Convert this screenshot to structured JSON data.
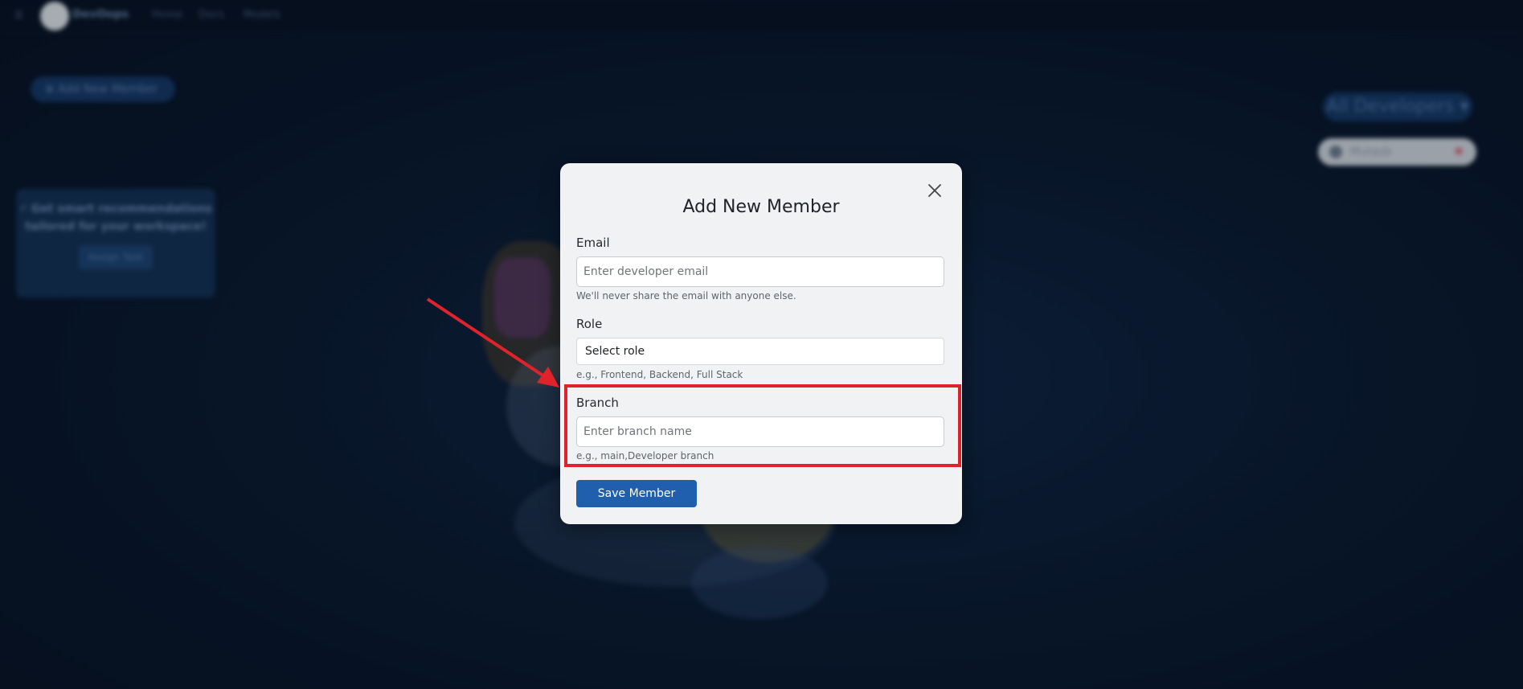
{
  "background": {
    "brand": "DevOops",
    "nav": [
      "Home",
      "Docs",
      "Models"
    ],
    "add_member_button": "⊕ Add New Member",
    "promo": {
      "text": "⚡ Get smart recommendations tailored for your workspace!",
      "button": "Assign Task"
    },
    "developer_filter": "All Developers ▾",
    "developer_chip": "Mutasb"
  },
  "modal": {
    "title": "Add New Member",
    "email": {
      "label": "Email",
      "placeholder": "Enter developer email",
      "help": "We'll never share the email with anyone else."
    },
    "role": {
      "label": "Role",
      "selected": "Select role",
      "help": "e.g., Frontend, Backend, Full Stack"
    },
    "branch": {
      "label": "Branch",
      "placeholder": "Enter branch name",
      "help": "e.g., main,Developer branch"
    },
    "save_label": "Save Member"
  },
  "colors": {
    "primary": "#1f5fad",
    "highlight": "#e0232b",
    "modal_bg": "#f1f2f4"
  },
  "icons": [
    "hamburger-icon",
    "close-icon",
    "arrow-annotation"
  ]
}
